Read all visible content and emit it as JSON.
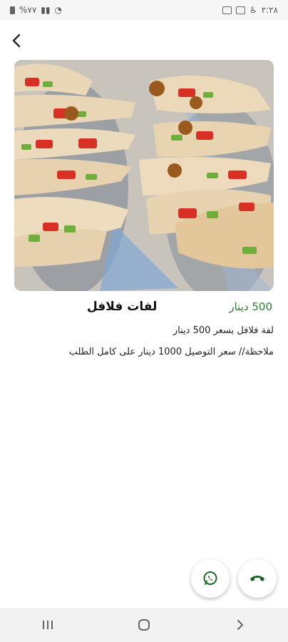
{
  "status_bar": {
    "time": "٢:٢٨",
    "battery": "%٧٧",
    "icons": [
      "battery-icon",
      "signal-icon",
      "signal-icon",
      "wifi-icon",
      "image-icon",
      "gallery-icon",
      "accessibility-icon"
    ]
  },
  "header": {
    "back_icon": "chevron-left-icon"
  },
  "product": {
    "title": "لفات فلافل",
    "price": "500 دينار",
    "description_line1": "لفة فلافل بسعر 500 دينار",
    "description_line2": "ملاحظة// سعر التوصيل 1000 دينار على كامل الطلب"
  },
  "actions": {
    "call_icon": "phone-icon",
    "whatsapp_icon": "whatsapp-icon"
  },
  "navbar": {
    "items": [
      "recents-icon",
      "home-icon",
      "back-icon"
    ]
  },
  "colors": {
    "price": "#2e7d32",
    "call": "#1b5e20",
    "whatsapp": "#1b6e2a"
  }
}
